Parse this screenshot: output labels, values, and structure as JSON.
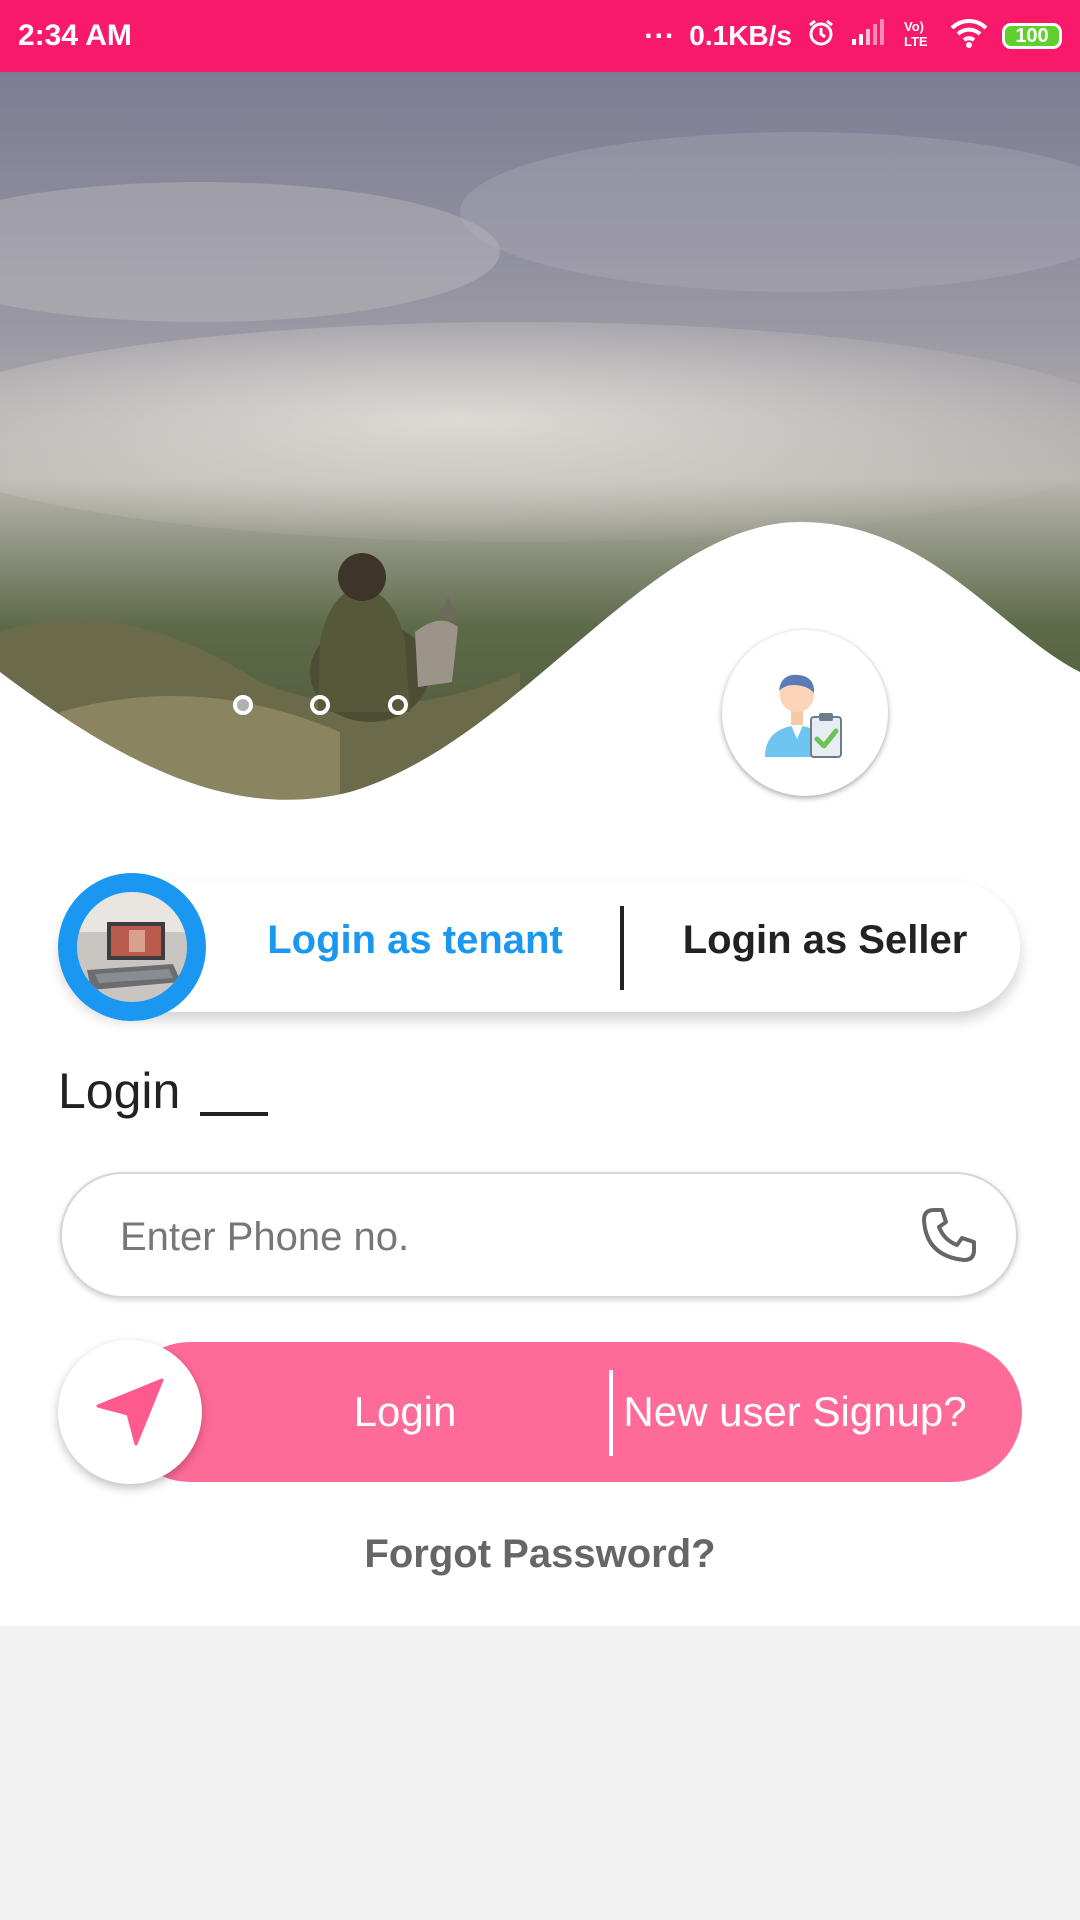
{
  "status_bar": {
    "time": "2:34 AM",
    "dots": "...",
    "speed": "0.1KB/s",
    "volte": "Vo) LTE",
    "battery": "100",
    "icons": [
      "alarm-icon",
      "signal-icon",
      "volte-icon",
      "wifi-icon",
      "battery-icon"
    ],
    "color": "#f8196b"
  },
  "hero": {
    "slides": 3,
    "active_slide": 1,
    "icons": [
      "seller-avatar-icon"
    ]
  },
  "role_toggle": {
    "tenant_label": "Login as tenant",
    "seller_label": "Login as Seller",
    "selected": "tenant",
    "accent_color": "#1a97f0"
  },
  "form": {
    "heading": "Login",
    "phone_placeholder": "Enter Phone no.",
    "phone_icon": "phone-icon"
  },
  "actions": {
    "login_label": "Login",
    "signup_label": "New user Signup?",
    "send_icon": "navigation-arrow-icon",
    "button_color": "#ff6b98"
  },
  "forgot_label": "Forgot Password?"
}
